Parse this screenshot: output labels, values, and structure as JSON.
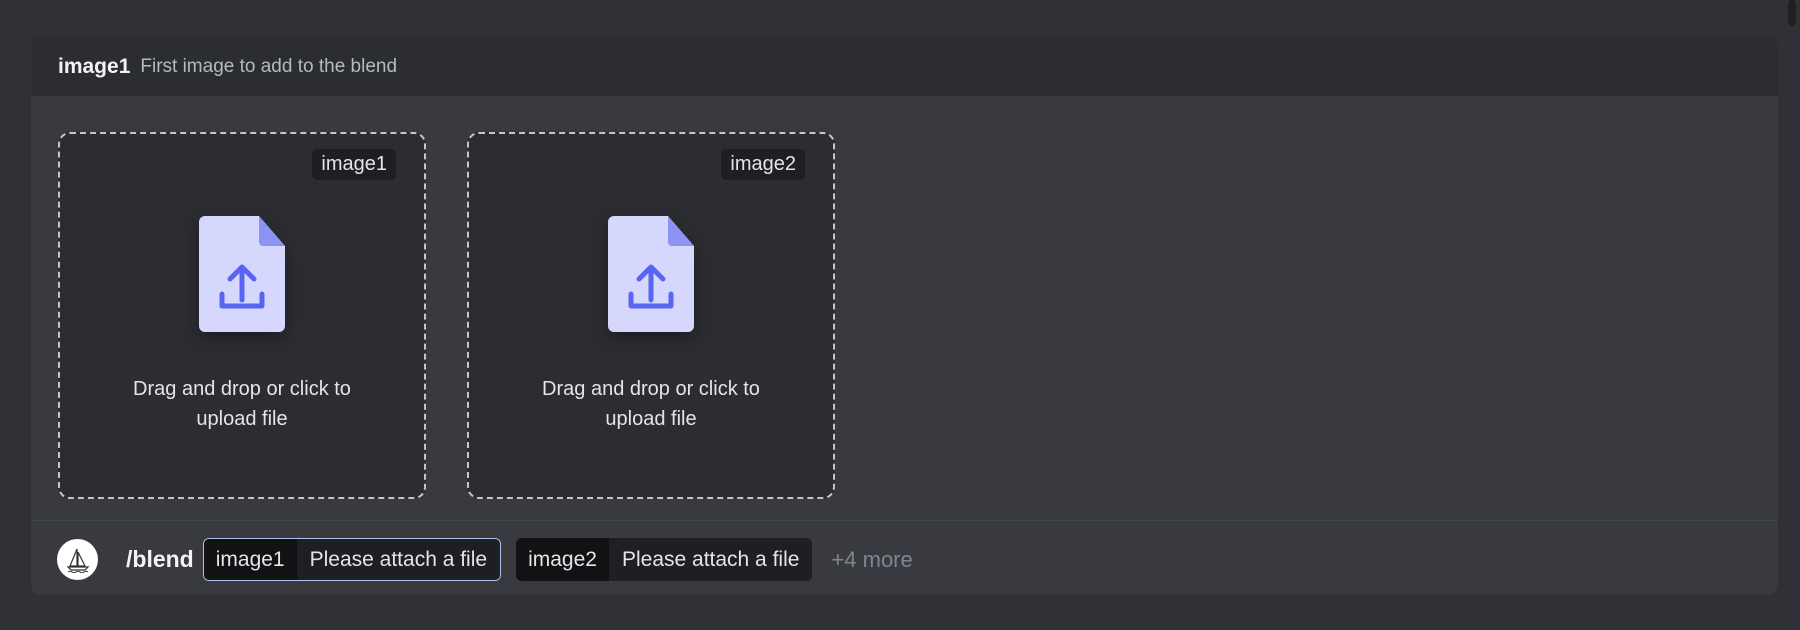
{
  "header": {
    "option_name": "image1",
    "option_description": "First image to add to the blend"
  },
  "uploads": [
    {
      "tag": "image1",
      "text_line1": "Drag and drop or click to",
      "text_line2": "upload file"
    },
    {
      "tag": "image2",
      "text_line1": "Drag and drop or click to",
      "text_line2": "upload file"
    }
  ],
  "command": {
    "name": "/blend",
    "params": [
      {
        "key": "image1",
        "value": "Please attach a file"
      },
      {
        "key": "image2",
        "value": "Please attach a file"
      }
    ],
    "more": "+4 more"
  },
  "colors": {
    "accent": "#5865f2",
    "file_icon": "#d6d7fc",
    "file_fold": "#8c93f2"
  }
}
